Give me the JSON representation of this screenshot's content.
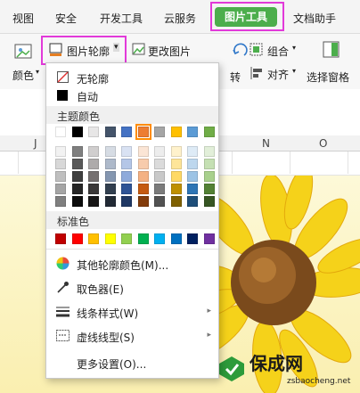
{
  "ribbon": {
    "tabs": [
      "视图",
      "安全",
      "开发工具",
      "云服务",
      "图片工具",
      "文档助手"
    ],
    "active_tab": "图片工具"
  },
  "toolbar": {
    "picture_outline": "图片轮廓",
    "change_picture": "更改图片",
    "color": "颜色",
    "rotate": "转",
    "group": "组合",
    "align": "对齐",
    "selection_pane": "选择窗格"
  },
  "columns": [
    "J",
    "N",
    "O"
  ],
  "menu": {
    "no_outline": "无轮廓",
    "automatic": "自动",
    "theme_colors_title": "主题颜色",
    "standard_colors_title": "标准色",
    "more_colors": "其他轮廓颜色(M)...",
    "eyedropper": "取色器(E)",
    "line_style": "线条样式(W)",
    "dash_type": "虚线线型(S)",
    "more_settings": "更多设置(O)..."
  },
  "theme_colors_top": [
    "#ffffff",
    "#000000",
    "#e7e6e6",
    "#44546a",
    "#4472c4",
    "#ed7d31",
    "#a5a5a5",
    "#ffc000",
    "#5b9bd5",
    "#70ad47"
  ],
  "theme_color_shades": [
    [
      "#f2f2f2",
      "#7f7f7f",
      "#d0cece",
      "#d6dce4",
      "#d9e2f3",
      "#fbe5d5",
      "#ededed",
      "#fff2cc",
      "#deebf6",
      "#e2efd9"
    ],
    [
      "#d8d8d8",
      "#595959",
      "#aeabab",
      "#adb9ca",
      "#b4c6e7",
      "#f7cbac",
      "#dbdbdb",
      "#fee599",
      "#bdd7ee",
      "#c5e0b3"
    ],
    [
      "#bfbfbf",
      "#3f3f3f",
      "#757070",
      "#8496b0",
      "#8eaadb",
      "#f4b183",
      "#c9c9c9",
      "#ffd965",
      "#9cc3e5",
      "#a8d08d"
    ],
    [
      "#a5a5a5",
      "#262626",
      "#3a3838",
      "#323f4f",
      "#2f5496",
      "#c55a11",
      "#7b7b7b",
      "#bf9000",
      "#2e75b5",
      "#538135"
    ],
    [
      "#7f7f7f",
      "#0c0c0c",
      "#171616",
      "#222a35",
      "#1f3864",
      "#833c0b",
      "#525252",
      "#7f6000",
      "#1e4e79",
      "#375623"
    ]
  ],
  "standard_colors": [
    "#c00000",
    "#ff0000",
    "#ffc000",
    "#ffff00",
    "#92d050",
    "#00b050",
    "#00b0f0",
    "#0070c0",
    "#002060",
    "#7030a0"
  ],
  "selected_theme_color": "#ed7d31",
  "watermark": {
    "brand": "保成网",
    "url": "zsbaocheng.net"
  },
  "colors": {
    "accent_green": "#4cae4c",
    "highlight": "#e23ad9"
  }
}
